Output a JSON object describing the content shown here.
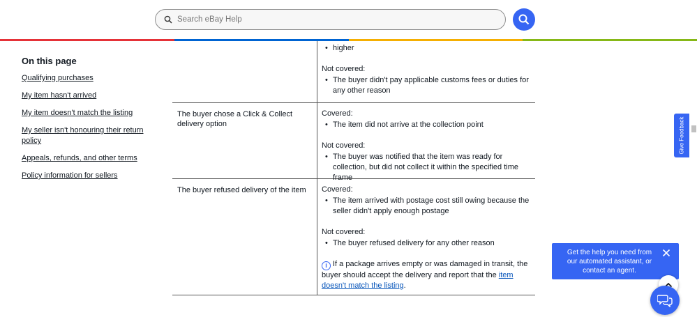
{
  "header": {
    "search_placeholder": "Search eBay Help",
    "search_button_icon": "search-icon",
    "brand_colors": [
      "#e53238",
      "#0064d2",
      "#f5af02",
      "#86b817"
    ]
  },
  "sidebar": {
    "title": "On this page",
    "links": [
      "Qualifying purchases",
      "My item hasn't arrived",
      "My item doesn't match the listing",
      "My seller isn't honouring their return policy",
      "Appeals, refunds, and other terms",
      "Policy information for sellers"
    ]
  },
  "table": {
    "row0": {
      "cont_text": "higher",
      "not_covered_label": "Not covered:",
      "not_covered": [
        "The buyer didn't pay applicable customs fees or duties for any other reason"
      ]
    },
    "row1": {
      "scenario": "The buyer chose a Click & Collect delivery option",
      "covered_label": "Covered:",
      "covered": [
        "The item did not arrive at the collection point"
      ],
      "not_covered_label": "Not covered:",
      "not_covered": [
        "The buyer was notified that the item was ready for collection, but did not collect it within the specified time frame"
      ]
    },
    "row2": {
      "scenario": "The buyer refused delivery of the item",
      "covered_label": "Covered:",
      "covered": [
        "The item arrived with postage cost still owing because the seller didn't apply enough postage"
      ],
      "not_covered_label": "Not covered:",
      "not_covered": [
        "The buyer refused delivery for any other reason"
      ],
      "info_text": "If a package arrives empty or was damaged in transit, the buyer should accept the delivery and report that the",
      "info_link": "item doesn't match the listing",
      "info_end": "."
    }
  },
  "feedback_tab": "Give Feedback",
  "chat": {
    "message": "Get the help you need from our automated assistant, or contact an agent.",
    "close_icon": "close-icon",
    "scroll_up_icon": "chevron-up-icon",
    "chat_icon": "chat-bubbles-icon"
  }
}
